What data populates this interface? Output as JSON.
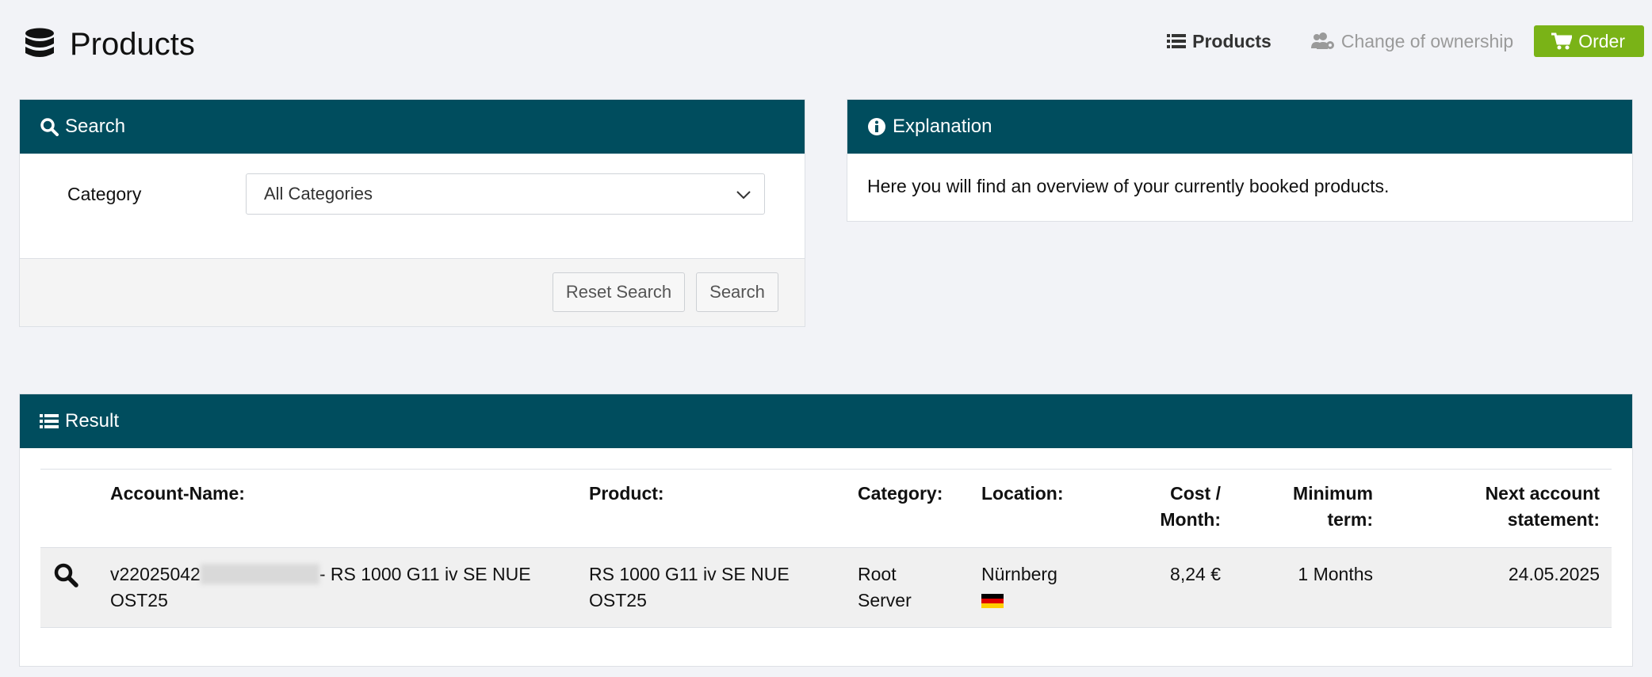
{
  "header": {
    "title": "Products",
    "icon": "database-icon"
  },
  "nav": {
    "products_label": "Products",
    "change_label": "Change of ownership",
    "order_label": "Order"
  },
  "search": {
    "title": "Search",
    "category_label": "Category",
    "category_value": "All Categories",
    "reset_label": "Reset Search",
    "search_label": "Search"
  },
  "explanation": {
    "title": "Explanation",
    "text": "Here you will find an overview of your currently booked products."
  },
  "result": {
    "title": "Result",
    "columns": {
      "account": "Account-Name:",
      "product": "Product:",
      "category": "Category:",
      "location": "Location:",
      "cost_line1": "Cost /",
      "cost_line2": "Month:",
      "min_line1": "Minimum",
      "min_line2": "term:",
      "next_line1": "Next account",
      "next_line2": "statement:"
    },
    "rows": [
      {
        "account_prefix": "v22025042",
        "account_suffix": "- RS 1000 G11 iv SE NUE",
        "account_line2": "OST25",
        "product_line1": "RS 1000 G11 iv SE NUE",
        "product_line2": "OST25",
        "category_line1": "Root",
        "category_line2": "Server",
        "location": "Nürnberg",
        "cost": "8,24 €",
        "min_term": "1 Months",
        "next_statement": "24.05.2025"
      }
    ]
  },
  "colors": {
    "panel_header": "#004d5e",
    "order_button": "#7ab317",
    "background": "#f2f3f7"
  }
}
